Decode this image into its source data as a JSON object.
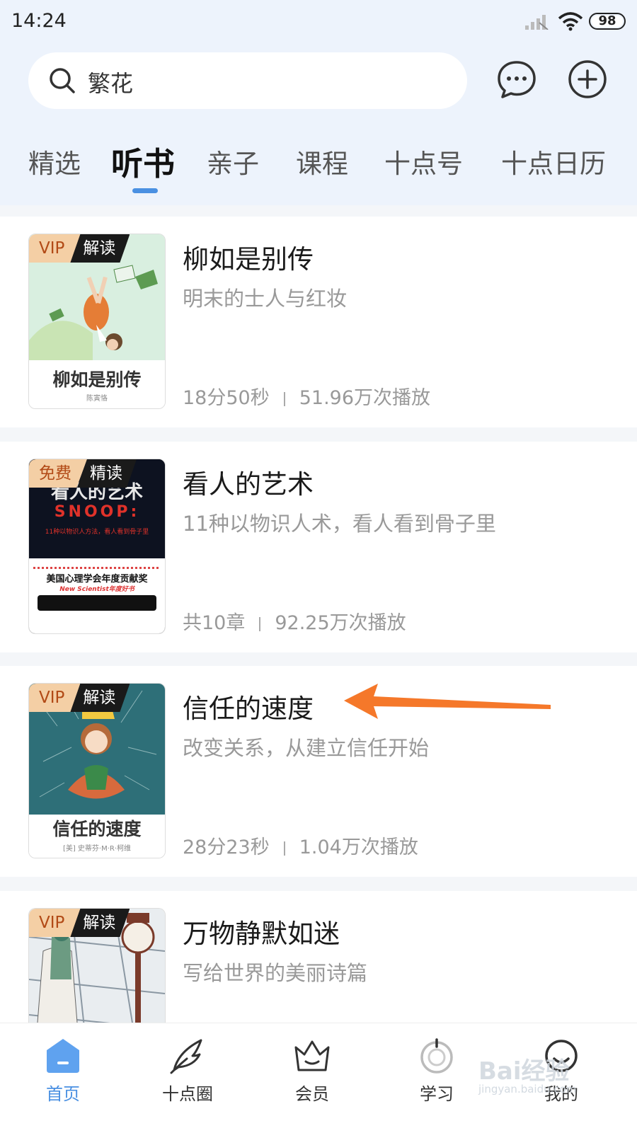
{
  "status_bar": {
    "time": "14:24",
    "battery": "98"
  },
  "search": {
    "text": "繁花"
  },
  "tabs": [
    {
      "label": "精选"
    },
    {
      "label": "听书",
      "active": true
    },
    {
      "label": "亲子"
    },
    {
      "label": "课程"
    },
    {
      "label": "十点号"
    },
    {
      "label": "十点日历"
    }
  ],
  "books": [
    {
      "badge1": "VIP",
      "badge2": "解读",
      "title": "柳如是别传",
      "subtitle": "明末的士人与红妆",
      "duration": "18分50秒",
      "plays": "51.96万次播放",
      "cover_title": "柳如是别传",
      "cover_author": "陈寅恪"
    },
    {
      "badge1": "免费",
      "badge2": "精读",
      "title": "看人的艺术",
      "subtitle": "11种以物识人术，看人看到骨子里",
      "duration": "共10章",
      "plays": "92.25万次播放",
      "cover_top": "看人的艺术",
      "cover_big": "SNOOP:",
      "cover_red": "11种以物识人方法，看人看到骨子里",
      "cover_award": "美国心理学会年度贡献奖",
      "cover_award2": "New Scientist年度好书"
    },
    {
      "badge1": "VIP",
      "badge2": "解读",
      "title": "信任的速度",
      "subtitle": "改变关系，从建立信任开始",
      "duration": "28分23秒",
      "plays": "1.04万次播放",
      "cover_title": "信任的速度",
      "cover_author": "[美] 史蒂芬·M·R·柯维"
    },
    {
      "badge1": "VIP",
      "badge2": "解读",
      "title": "万物静默如迷",
      "subtitle": "写给世界的美丽诗篇"
    }
  ],
  "bottom_nav": [
    {
      "label": "首页",
      "icon": "home-icon",
      "active": true
    },
    {
      "label": "十点圈",
      "icon": "feather-icon"
    },
    {
      "label": "会员",
      "icon": "crown-icon"
    },
    {
      "label": "学习",
      "icon": "study-icon"
    },
    {
      "label": "我的",
      "icon": "profile-icon"
    }
  ],
  "watermark": {
    "text": "Bai经验",
    "sub": "jingyan.baidu.com"
  },
  "colors": {
    "accent": "#4a90e2",
    "arrow": "#f5782a",
    "vip_bg": "#f4cfa5",
    "vip_text": "#b24a16"
  }
}
